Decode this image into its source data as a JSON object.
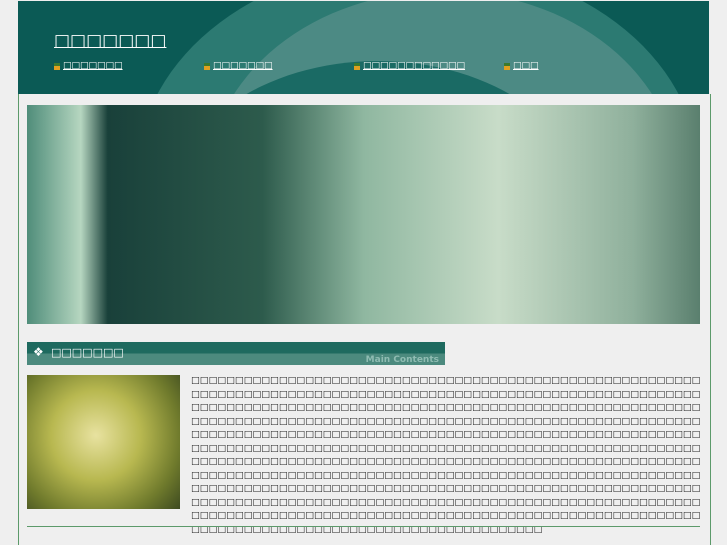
{
  "header": {
    "title": "□□□□□□□",
    "nav": [
      "□□□□□□□",
      "□□□□□□□",
      "□□□□□□□□□□□□",
      "□□□"
    ]
  },
  "section": {
    "heading": "□□□□□□□",
    "subtitle": "Main Contents",
    "icon": "diamond-cluster-icon",
    "body": "□□□□□□□□□□□□□□□□□□□□□□□□□□□□□□□□□□□□□□□□□□□□□□□□□□□□□□□□□□□□□□□□□□□□□□□□□□□□□□□□□□□□□□□□□□□□□□□□□□□□□□□□□□□□□□□□□□□□□□□□□□□□□□□□□□□□□□□□□□□□□□□□□□□□□□□□□□□□□□□□□□□□□□□□□□□□□□□□□□□□□□□□□□□□□□□□□□□□□□□□□□□□□□□□□□□□□□□□□□□□□□□□□□□□□□□□□□□□□□□□□□□□□□□□□□□□□□□□□□□□□□□□□□□□□□□□□□□□□□□□□□□□□□□□□□□□□□□□□□□□□□□□□□□□□□□□□□□□□□□□□□□□□□□□□□□□□□□□□□□□□□□□□□□□□□□□□□□□□□□□□□□□□□□□□□□□□□□□□□□□□□□□□□□□□□□□□□□□□□□□□□□□□□□□□□□□□□□□□□□□□□□□□□□□□□□□□□□□□□□□□□□□□□□□□□□□□□□□□□□□□□□□□□□□□□□□□□□□□□□□□□□□□□□□□□□□□□□□□□□□□□□□□□□□□□□□□□□□□□□□□□□□□□□□□□□□□□□□□□□□□□□□□□□□□□□□□□□□□□□□□□□□□□□□□□□□□□□□□□□□□□□□□□□□□□□□□□□□□□□□□□□□□□□□□□□□□□□□□□□□□□□□□□□□□□□□□□□□□□□□□□□□□□□□□□□□□□□□□□□□□□□□□□□□□□□□□□□□□□"
  }
}
